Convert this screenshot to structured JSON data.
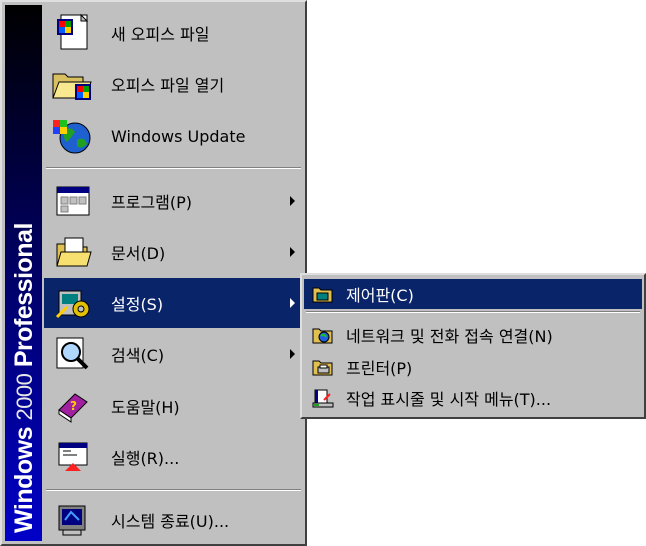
{
  "banner": {
    "brand": "Windows",
    "edition": "2000",
    "product": "Professional"
  },
  "start_menu": {
    "items": [
      {
        "label": "새 오피스 파일",
        "icon": "office-new-file-icon"
      },
      {
        "label": "오피스 파일 열기",
        "icon": "office-open-file-icon"
      },
      {
        "label": "Windows Update",
        "icon": "windows-update-globe-icon"
      },
      {
        "label": "프로그램(P)",
        "icon": "programs-icon",
        "submenu": true
      },
      {
        "label": "문서(D)",
        "icon": "documents-folder-icon",
        "submenu": true
      },
      {
        "label": "설정(S)",
        "icon": "settings-icon",
        "submenu": true,
        "selected": true
      },
      {
        "label": "검색(C)",
        "icon": "search-icon",
        "submenu": true
      },
      {
        "label": "도움말(H)",
        "icon": "help-book-icon"
      },
      {
        "label": "실행(R)...",
        "icon": "run-icon"
      },
      {
        "label": "시스템 종료(U)...",
        "icon": "shutdown-icon"
      }
    ]
  },
  "settings_submenu": {
    "items": [
      {
        "label": "제어판(C)",
        "icon": "control-panel-icon",
        "selected": true
      },
      {
        "label": "네트워크 및 전화 접속 연결(N)",
        "icon": "network-connections-icon"
      },
      {
        "label": "프린터(P)",
        "icon": "printers-icon"
      },
      {
        "label": "작업 표시줄 및 시작 메뉴(T)...",
        "icon": "taskbar-startmenu-icon"
      }
    ]
  },
  "colors": {
    "menu_bg": "#c0c0c0",
    "highlight": "#0a246a",
    "banner": "#0000c8"
  }
}
